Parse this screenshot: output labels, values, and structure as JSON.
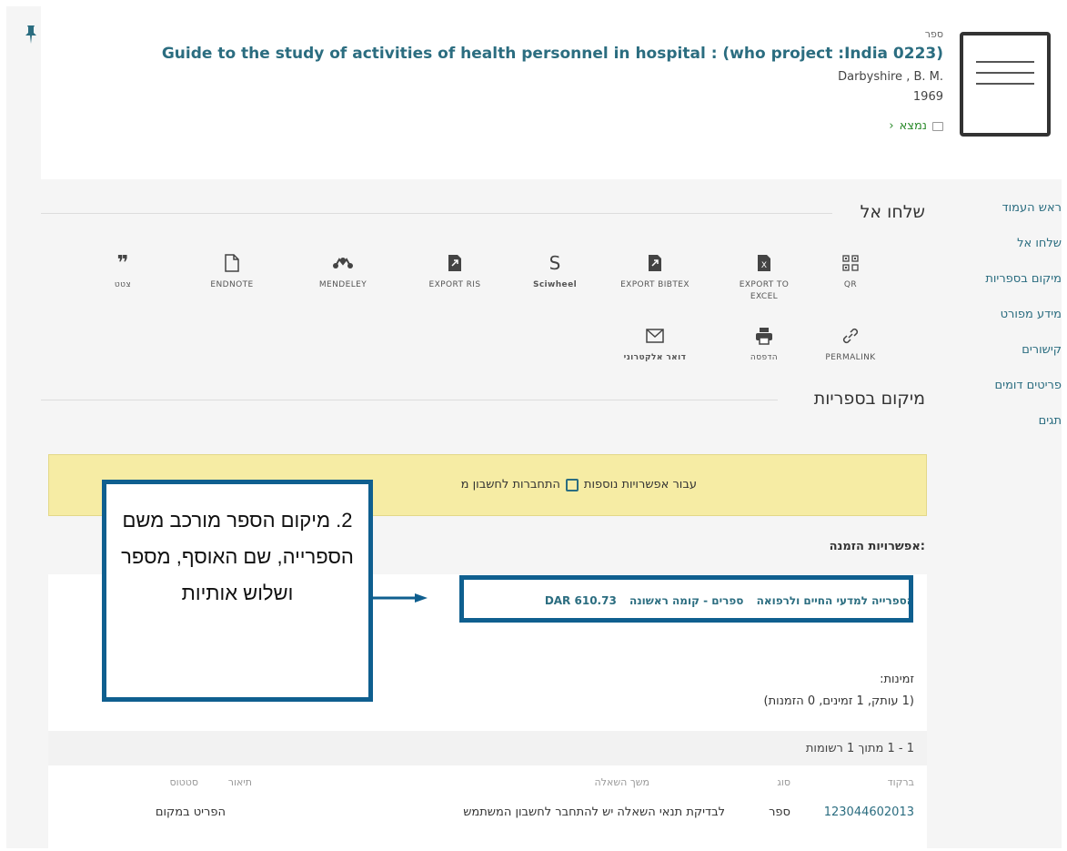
{
  "record": {
    "type": "ספר",
    "title": "Guide to the study of activities of health personnel in hospital : (who project :India 0223)",
    "author": "Darbyshire , B. M.",
    "year": "1969",
    "availability": "נמצא",
    "availability_chevron": "‹"
  },
  "sidenav": {
    "items": [
      {
        "label": "ראש העמוד"
      },
      {
        "label": "שלחו אל"
      },
      {
        "label": "מיקום בספריות"
      },
      {
        "label": "מידע מפורט"
      },
      {
        "label": "קישורים"
      },
      {
        "label": "פריטים דומים"
      },
      {
        "label": "תגים"
      }
    ]
  },
  "send_to": {
    "heading": "שלחו אל",
    "tools": [
      {
        "label": "QR",
        "icon": "qr-icon"
      },
      {
        "label": "EXPORT TO EXCEL",
        "icon": "excel-icon"
      },
      {
        "label": "EXPORT BIBTEX",
        "icon": "bibtex-icon"
      },
      {
        "label": "Sciwheel",
        "icon": "sciwheel-icon",
        "glyph": "S"
      },
      {
        "label": "EXPORT RIS",
        "icon": "ris-icon"
      },
      {
        "label": "MENDELEY",
        "icon": "mendeley-icon"
      },
      {
        "label": "ENDNOTE",
        "icon": "endnote-icon"
      },
      {
        "label": "צטט",
        "icon": "citation-icon",
        "glyph": "❞"
      },
      {
        "label": "PERMALINK",
        "icon": "link-icon"
      },
      {
        "label": "הדפסה",
        "icon": "print-icon"
      },
      {
        "label": "דואר אלקטרוני",
        "icon": "email-icon"
      }
    ]
  },
  "locations": {
    "heading": "מיקום בספריות",
    "alert_text": "עבור אפשרויות נוספות",
    "alert_link": "התחברות לחשבון מ",
    "order_options_label": "אפשרויות הזמנה:",
    "library": "הספרייה למדעי החיים ולרפואה",
    "collection": "ספרים - קומה ראשונה",
    "call_number": "610.73 DAR",
    "availability_label": "זמינות:",
    "availability_counts": "(1 עותק, 1 זמינים, 0 הזמנות)",
    "records_count": "1 - 1 מתוך 1 רשומות",
    "columns": {
      "barcode": "ברקוד",
      "type": "סוג",
      "loan_period": "משך השאלה",
      "description": "תיאור",
      "status": "סטטוס"
    },
    "row": {
      "barcode": "123044602013",
      "type": "ספר",
      "loan_period": "לבדיקת תנאי השאלה יש להתחבר לחשבון המשתמש",
      "description": "",
      "status": "הפריט במקום"
    }
  },
  "annotation": {
    "text": "2. מיקום הספר מורכב משם הספרייה, שם האוסף, מספר ושלוש אותיות"
  },
  "colors": {
    "link": "#2b6d80",
    "callout_border": "#0f5f8f",
    "alert_bg": "#f6eca4",
    "available_green": "#2a8a2a"
  }
}
